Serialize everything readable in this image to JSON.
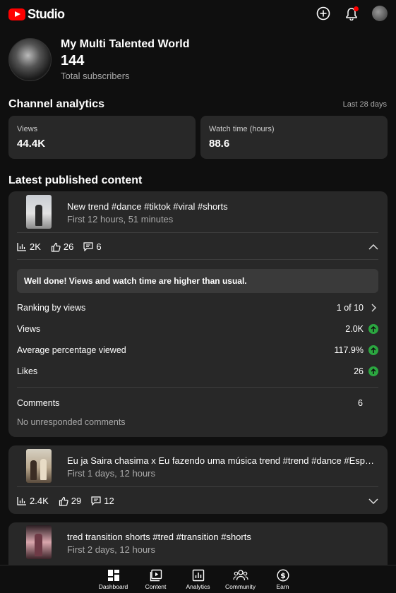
{
  "app": {
    "logo_text": "Studio"
  },
  "channel": {
    "name": "My Multi Talented World",
    "subscribers": "144",
    "subscribers_label": "Total subscribers"
  },
  "analytics": {
    "title": "Channel analytics",
    "period": "Last 28 days",
    "cards": [
      {
        "label": "Views",
        "value": "44.4K"
      },
      {
        "label": "Watch time (hours)",
        "value": "88.6"
      }
    ]
  },
  "latest": {
    "title": "Latest published content",
    "videos": [
      {
        "title": "New trend #dance #tiktok #viral #shorts",
        "age": "First 12 hours, 51 minutes",
        "views": "2K",
        "likes": "26",
        "comments": "6",
        "expanded": true,
        "banner": "Well done! Views and watch time are higher than usual.",
        "details": [
          {
            "label": "Ranking by views",
            "value": "1 of 10"
          },
          {
            "label": "Views",
            "value": "2.0K"
          },
          {
            "label": "Average percentage viewed",
            "value": "117.9%"
          },
          {
            "label": "Likes",
            "value": "26"
          }
        ],
        "comments_label": "Comments",
        "comments_value": "6",
        "unresponded": "No unresponded comments"
      },
      {
        "title": "Eu ja Saira chasima x Eu fazendo uma música trend #trend #dance #Español #viral #shorts",
        "age": "First 1 days, 12 hours",
        "views": "2.4K",
        "likes": "29",
        "comments": "12"
      },
      {
        "title": "tred transition shorts #tred #transition #shorts",
        "age": "First 2 days, 12 hours"
      }
    ]
  },
  "nav": [
    "Dashboard",
    "Content",
    "Analytics",
    "Community",
    "Earn"
  ],
  "colors": {
    "accent_red": "#ff0000",
    "up_green": "#2ba640",
    "card_bg": "#282828"
  }
}
